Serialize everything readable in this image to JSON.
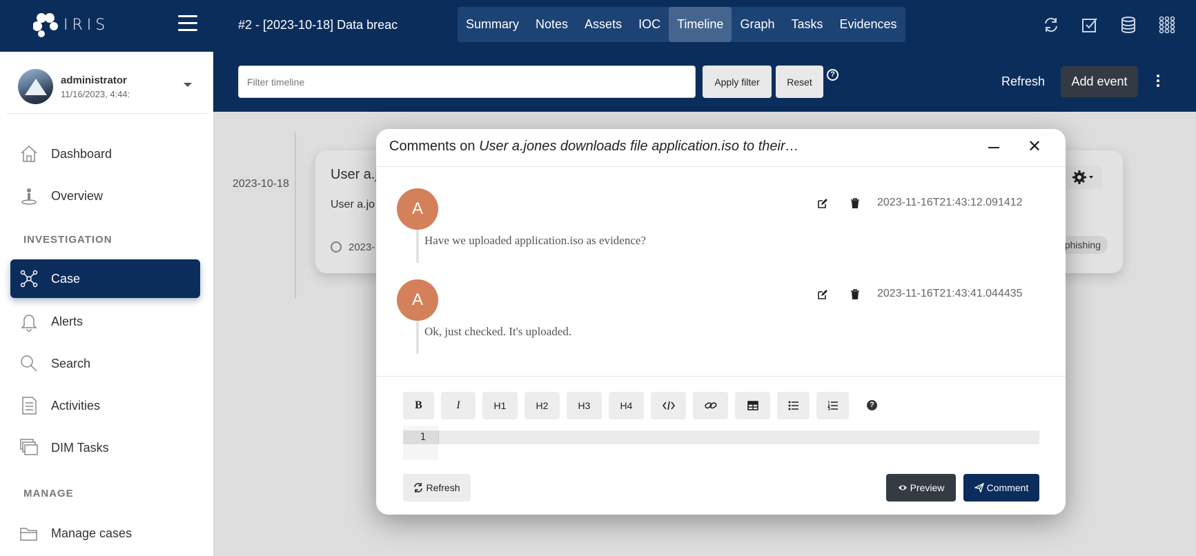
{
  "app": {
    "logo_text": "IRIS"
  },
  "header": {
    "case_title": "#2 - [2023-10-18] Data breac",
    "tabs": [
      {
        "label": "Summary"
      },
      {
        "label": "Notes"
      },
      {
        "label": "Assets"
      },
      {
        "label": "IOC"
      },
      {
        "label": "Timeline",
        "active": true
      },
      {
        "label": "Graph"
      },
      {
        "label": "Tasks"
      },
      {
        "label": "Evidences"
      }
    ],
    "icons": [
      "sync-icon",
      "checkbox-icon",
      "database-icon",
      "apps-grid-icon"
    ]
  },
  "user": {
    "name": "administrator",
    "date": "11/16/2023, 4:44:"
  },
  "sidebar": {
    "items": [
      {
        "label": "Dashboard",
        "icon": "home-icon"
      },
      {
        "label": "Overview",
        "icon": "overview-icon"
      },
      {
        "label": "Case",
        "icon": "case-network-icon",
        "active": true
      },
      {
        "label": "Alerts",
        "icon": "bell-icon"
      },
      {
        "label": "Search",
        "icon": "search-icon"
      },
      {
        "label": "Activities",
        "icon": "activities-icon"
      },
      {
        "label": "DIM Tasks",
        "icon": "windows-icon"
      },
      {
        "label": "Manage cases",
        "icon": "folder-icon"
      }
    ],
    "sections": {
      "investigation": "INVESTIGATION",
      "manage": "MANAGE"
    }
  },
  "filterbar": {
    "placeholder": "Filter timeline",
    "apply_label": "Apply filter",
    "reset_label": "Reset",
    "help_glyph": "?",
    "refresh_label": "Refresh",
    "add_event_label": "Add event"
  },
  "timeline": {
    "date": "2023-10-18",
    "card_title": "User a.j",
    "card_desc": "User a.jo",
    "card_time": "2023-",
    "tag": "phishing"
  },
  "modal": {
    "title_prefix": "Comments on ",
    "title_italic": "User a.jones downloads file application.iso to their…",
    "comments": [
      {
        "initial": "A",
        "timestamp": "2023-11-16T21:43:12.091412",
        "text": "Have we uploaded application.iso as evidence?"
      },
      {
        "initial": "A",
        "timestamp": "2023-11-16T21:43:41.044435",
        "text": "Ok, just checked. It's uploaded."
      }
    ],
    "toolbar": {
      "bold": "B",
      "italic": "I",
      "h1": "H1",
      "h2": "H2",
      "h3": "H3",
      "h4": "H4",
      "help": "?"
    },
    "editor_line_number": "1",
    "refresh_label": "Refresh",
    "preview_label": "Preview",
    "comment_label": "Comment"
  },
  "colors": {
    "navy": "#0b2d5c",
    "avatar_orange": "#d4805a",
    "dark_button": "#353b43"
  }
}
